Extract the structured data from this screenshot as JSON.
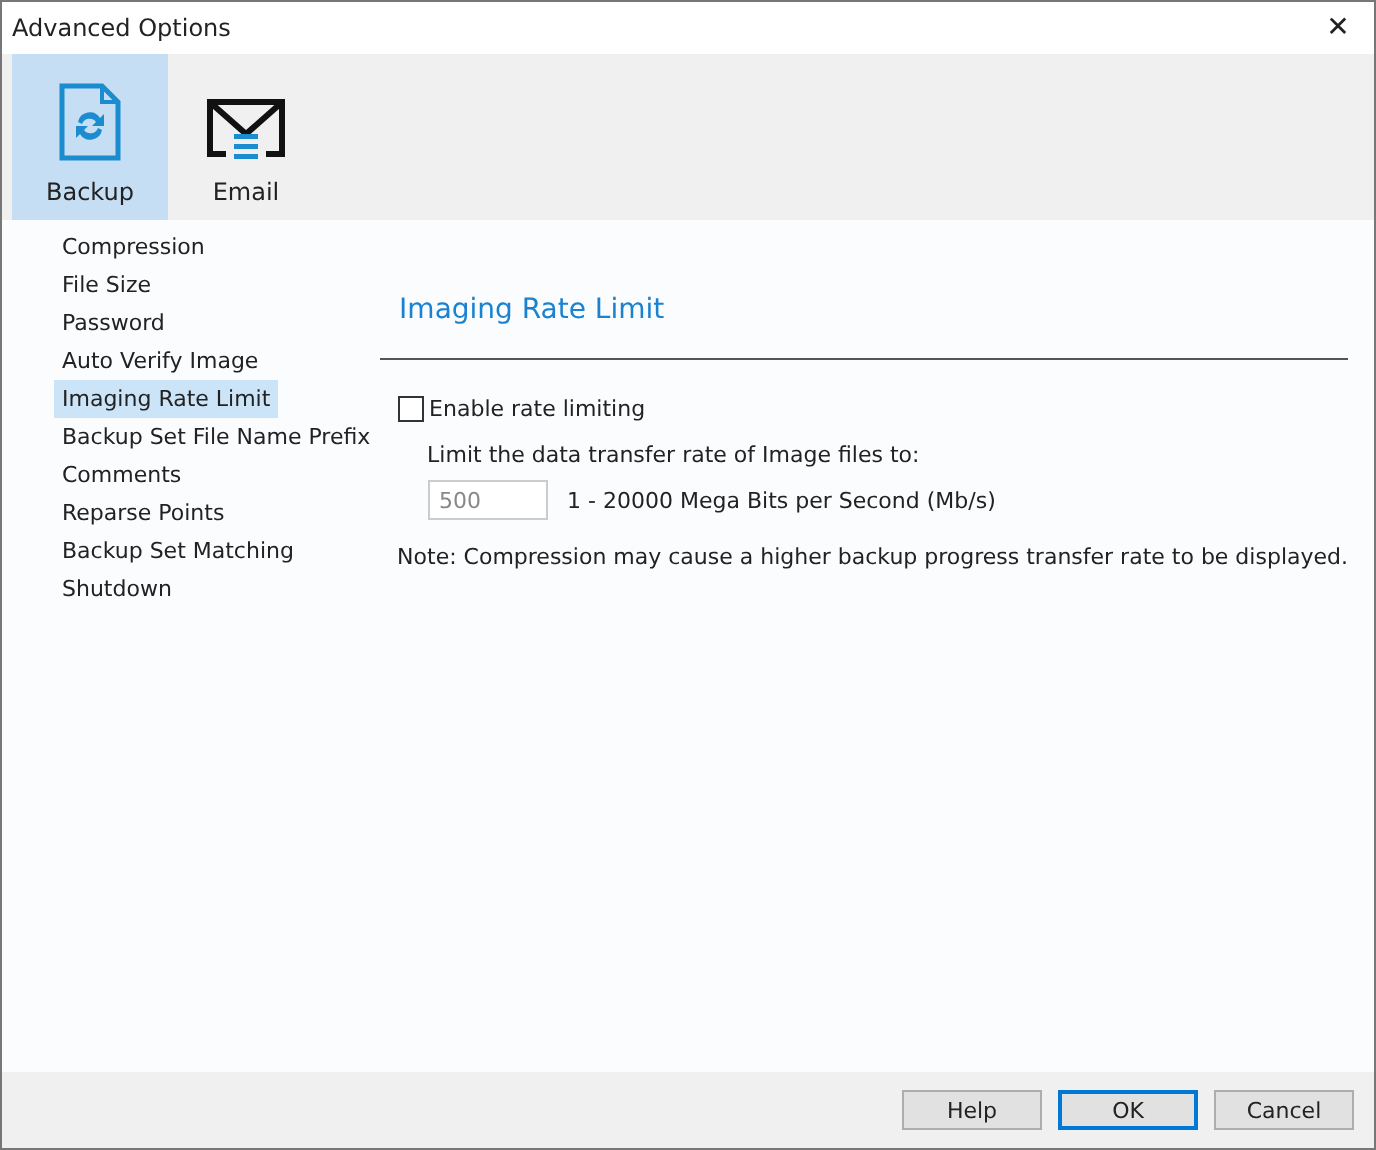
{
  "window": {
    "title": "Advanced Options",
    "close": "✕"
  },
  "toolbar": [
    {
      "label": "Backup",
      "kind": "backup",
      "selected": true
    },
    {
      "label": "Email",
      "kind": "email",
      "selected": false
    }
  ],
  "sidebar": {
    "items": [
      {
        "label": "Compression",
        "selected": false
      },
      {
        "label": "File Size",
        "selected": false
      },
      {
        "label": "Password",
        "selected": false
      },
      {
        "label": "Auto Verify Image",
        "selected": false
      },
      {
        "label": "Imaging Rate Limit",
        "selected": true
      },
      {
        "label": "Backup Set File Name Prefix",
        "selected": false
      },
      {
        "label": "Comments",
        "selected": false
      },
      {
        "label": "Reparse Points",
        "selected": false
      },
      {
        "label": "Backup Set Matching",
        "selected": false
      },
      {
        "label": "Shutdown",
        "selected": false
      }
    ]
  },
  "panel": {
    "heading": "Imaging Rate Limit",
    "enable": {
      "label": "Enable rate limiting",
      "checked": false
    },
    "limit_label": "Limit the data transfer rate of Image files to:",
    "rate": {
      "value": "500",
      "disabled": true
    },
    "range": "1 - 20000 Mega Bits per Second (Mb/s)",
    "note": "Note: Compression may cause a higher backup progress transfer rate to be displayed."
  },
  "buttons": [
    {
      "label": "Help",
      "default": false
    },
    {
      "label": "OK",
      "default": true
    },
    {
      "label": "Cancel",
      "default": false
    }
  ]
}
